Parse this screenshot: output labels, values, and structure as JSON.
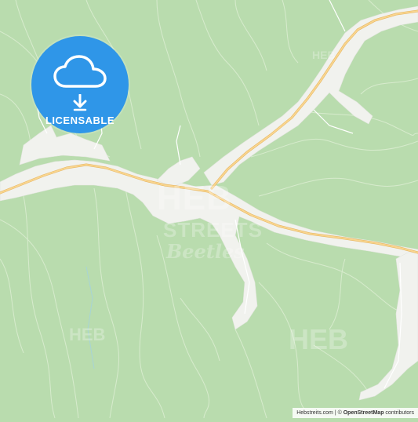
{
  "map": {
    "colors": {
      "land": "#b9dcae",
      "built_area": "#f2f2ef",
      "streams": "#d7ebcf",
      "main_road": "#f5c97a",
      "minor_road": "#ffffff",
      "water": "#9fd0e6"
    }
  },
  "badge": {
    "label": "LICENSABLE",
    "icon": "cloud-download-icon",
    "color": "#2f96e8"
  },
  "watermarks": {
    "heb": "HEB",
    "streets": "STREETS",
    "script": "Beetles"
  },
  "attribution": {
    "site": "Hebstreits.com",
    "separator": "|",
    "copyright": "©",
    "osm": "OpenStreetMap",
    "contributors": "contributors"
  }
}
